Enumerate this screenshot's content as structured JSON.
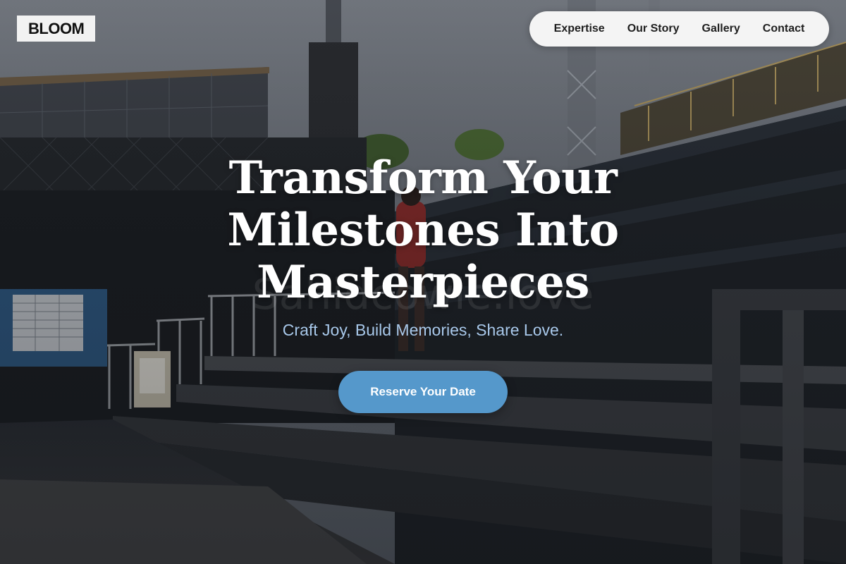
{
  "brand": {
    "logo_text": "BLOOM"
  },
  "nav": {
    "items": [
      {
        "label": "Expertise"
      },
      {
        "label": "Our Story"
      },
      {
        "label": "Gallery"
      },
      {
        "label": "Contact"
      }
    ]
  },
  "hero": {
    "title_lines": [
      "Transform Your",
      "Milestones Into",
      "Masterpieces"
    ],
    "subtitle": "Craft Joy, Build Memories, Share Love.",
    "cta_label": "Reserve Your Date",
    "background_description_icon": "stadium-steps-photo"
  },
  "colors": {
    "cta": "#5598cb",
    "subtitle": "#a8c8ea",
    "nav_bg": "#f4f4f4",
    "logo_bg": "#f2f2f2"
  }
}
